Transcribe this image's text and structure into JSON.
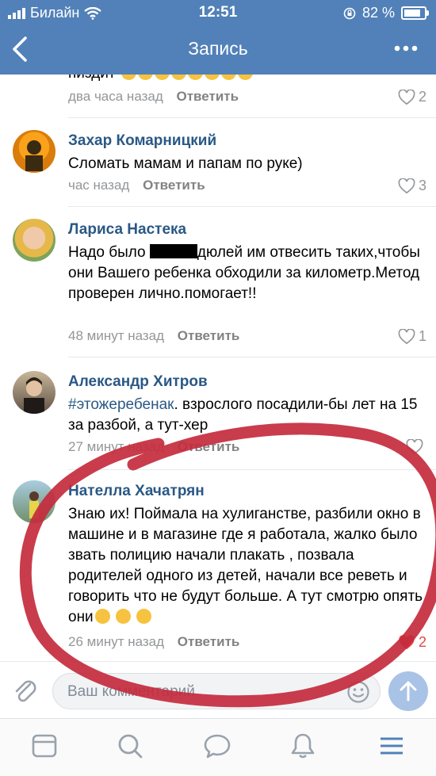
{
  "status_bar": {
    "carrier": "Билайн",
    "time": "12:51",
    "battery": "82 %"
  },
  "header": {
    "title": "Запись"
  },
  "comments": [
    {
      "author": "",
      "text": "пиздит",
      "time": "два часа назад",
      "reply": "Ответить",
      "likes": "2"
    },
    {
      "author": "Захар Комарницкий",
      "text": "Сломать мамам и папам по руке)",
      "time": "час назад",
      "reply": "Ответить",
      "likes": "3"
    },
    {
      "author": "Лариса Настека",
      "text_before": "Надо было ",
      "text_after": "дюлей им отвесить таких,чтобы они Вашего ребенка обходили за километр.Метод проверен лично.помогает!!",
      "time": "48 минут назад",
      "reply": "Ответить",
      "likes": "1"
    },
    {
      "author": "Александр Хитров",
      "hashtag": "#этожеребенак",
      "text": ". взрослого посадили-бы лет на 15 за разбой, а тут-хер",
      "time": "27 минут назад",
      "reply": "Ответить",
      "likes": ""
    },
    {
      "author": "Нателла Хачатрян",
      "text": "Знаю их! Поймала на хулиганстве, разбили окно в машине и в магазине где я работала, жалко было звать полицию начали плакать , позвала родителей одного из детей, начали все реветь и говорить что не будут больше. А тут смотрю опять они",
      "time": "26 минут назад",
      "reply": "Ответить",
      "likes": "2"
    }
  ],
  "input": {
    "placeholder": "Ваш комментарий"
  },
  "colors": {
    "accent": "#5181b8",
    "link": "#2a5885",
    "muted": "#939699",
    "annotation": "#c42b3d"
  },
  "icons": [
    "back-icon",
    "more-icon",
    "heart-icon",
    "attach-icon",
    "smile-icon",
    "send-icon",
    "news-icon",
    "search-icon",
    "messages-icon",
    "notifications-icon",
    "menu-icon"
  ]
}
